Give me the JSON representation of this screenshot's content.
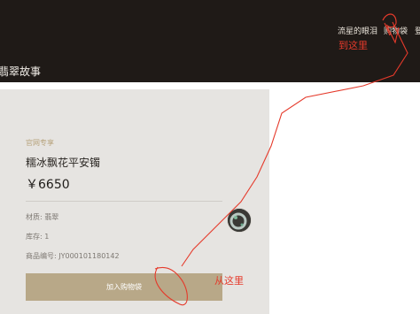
{
  "header": {
    "nav": [
      "流星的眼泪",
      "购物袋",
      "登"
    ],
    "brand": "翡翠故事"
  },
  "product": {
    "tag": "官网专享",
    "title": "糯冰飘花平安镯",
    "price": "￥6650",
    "material": "材质: 翡翠",
    "stock": "库存: 1",
    "sku": "商品编号: JY000101180142",
    "add_to_bag": "加入购物袋"
  },
  "annotations": {
    "to_here": "到这里",
    "from_here": "从这里",
    "color": "#e53a2b"
  },
  "colors": {
    "header_bg": "#1f1a17",
    "card_bg": "#e6e4e1",
    "button_bg": "#b8a888",
    "tag": "#b7a27a"
  }
}
